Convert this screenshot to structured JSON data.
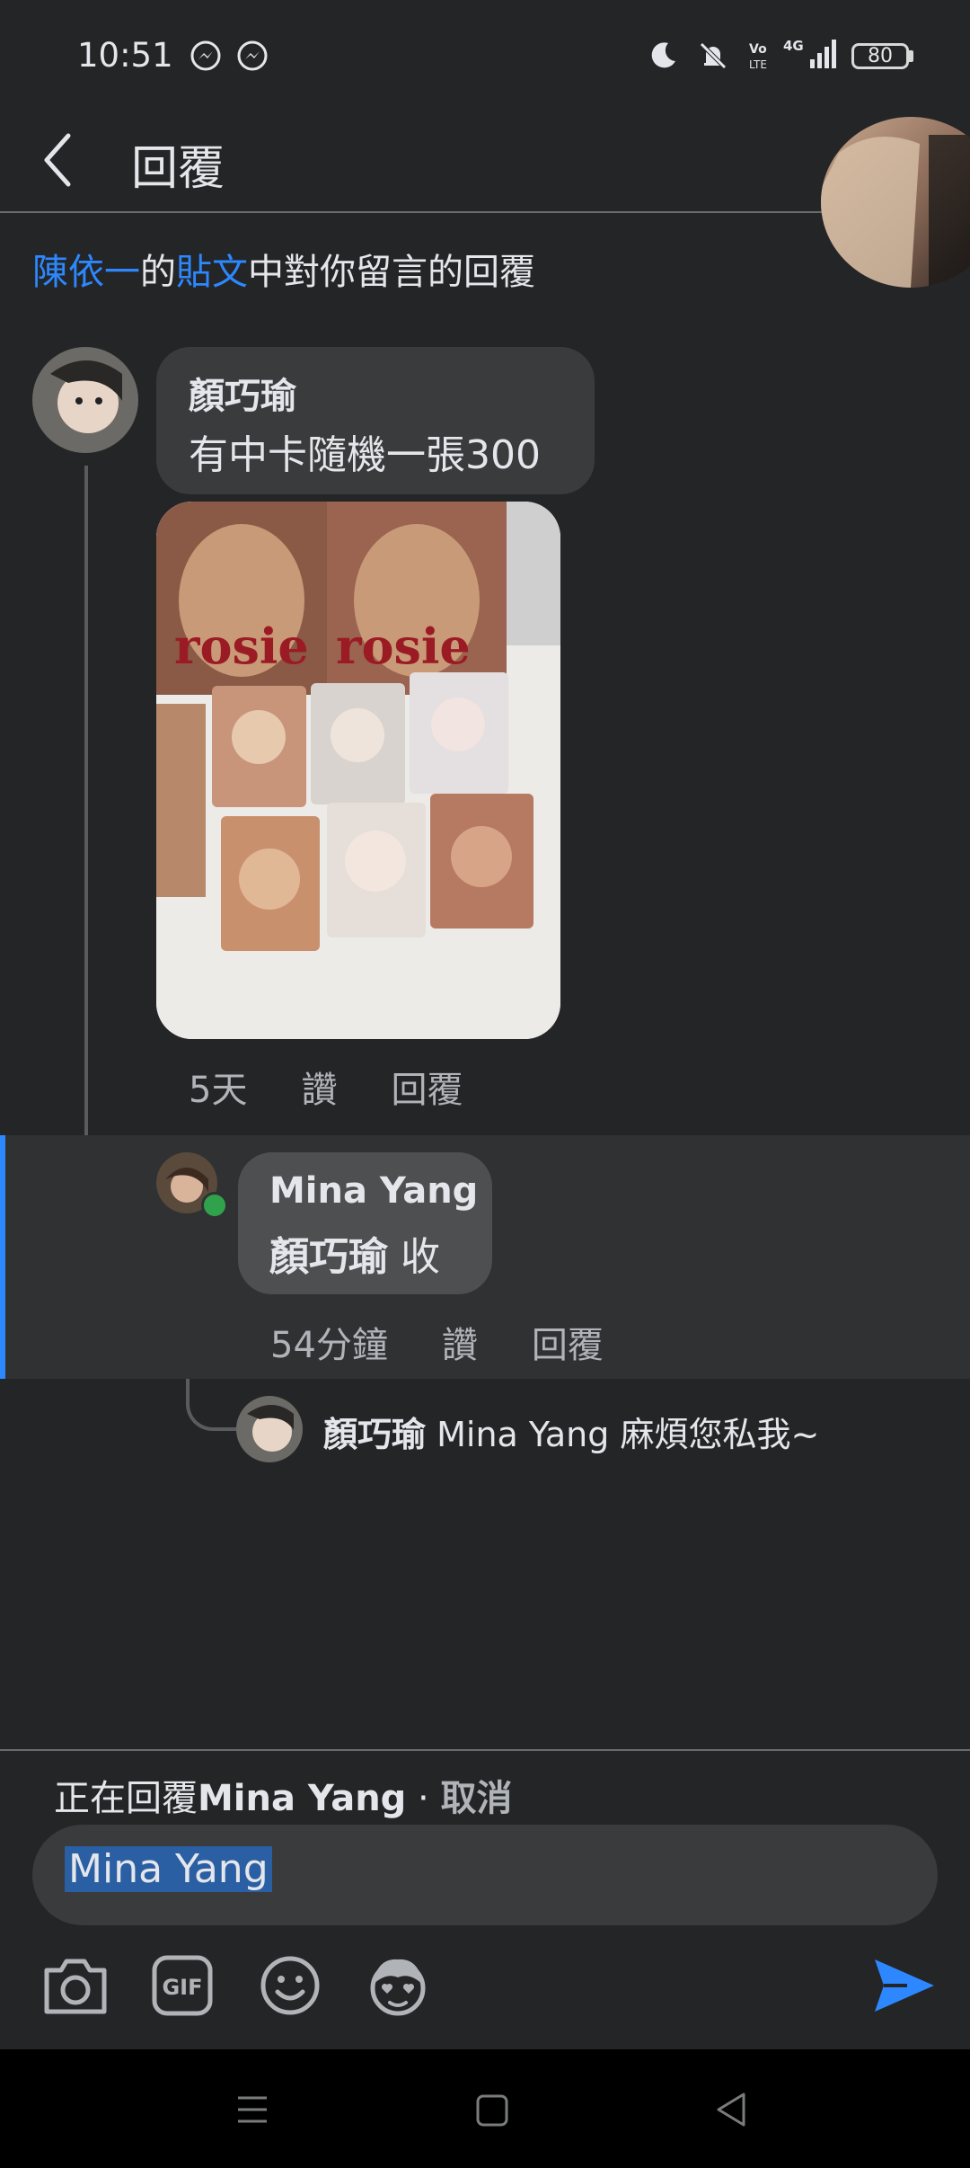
{
  "status_bar": {
    "time": "10:51",
    "icons": [
      "messenger-icon",
      "messenger-icon",
      "moon-icon",
      "bell-muted-icon",
      "volte-icon",
      "signal-4g-icon"
    ],
    "battery": "80"
  },
  "header": {
    "back_icon": "chevron-left-icon",
    "title": "回覆"
  },
  "context": {
    "author": "陳依一",
    "of": "的",
    "post": "貼文",
    "rest": "中對你留言的回覆"
  },
  "comment_1": {
    "name": "顏巧瑜",
    "text": "有中卡隨機一張300",
    "photo_lettering": "rosie",
    "time": "5天",
    "like": "讚",
    "reply": "回覆"
  },
  "comment_2": {
    "name": "Mina Yang",
    "mention": "顏巧瑜",
    "text": "收",
    "time": "54分鐘",
    "like": "讚",
    "reply": "回覆"
  },
  "comment_3": {
    "name": "顏巧瑜",
    "text": "Mina Yang 麻煩您私我~"
  },
  "composer": {
    "replying_prefix": "正在回覆",
    "replying_name": "Mina Yang",
    "separator": " · ",
    "cancel": "取消",
    "input_value": "Mina Yang",
    "tool_icons": [
      "camera-icon",
      "gif-icon",
      "emoji-icon",
      "avatar-sticker-icon"
    ],
    "send_icon": "send-icon"
  },
  "accent": "#2d88ff"
}
